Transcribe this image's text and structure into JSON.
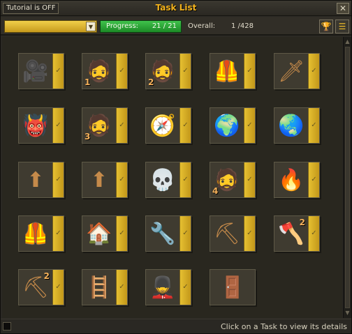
{
  "window": {
    "title": "Task List",
    "tutorial_label": "Tutorial is OFF",
    "close_symbol": "✕"
  },
  "toolbar": {
    "filter_value": "",
    "progress_label": "Progress:",
    "progress_value": "21 / 21",
    "progress_fraction": 1.0,
    "overall_label": "Overall:",
    "overall_value": "1 /428",
    "trophy_icon": "trophy-icon",
    "list_icon": "list-icon"
  },
  "tasks": [
    {
      "icon": "camera-rotate-icon",
      "glyph": "🎥",
      "badge": ""
    },
    {
      "icon": "guide-portrait-icon",
      "glyph": "🧔",
      "badge": "1"
    },
    {
      "icon": "guide-portrait-icon",
      "glyph": "🧔",
      "badge": "2"
    },
    {
      "icon": "armour-icon",
      "glyph": "🦺",
      "badge": ""
    },
    {
      "icon": "sword-icon",
      "glyph": "🗡",
      "badge": ""
    },
    {
      "icon": "goblin-icon",
      "glyph": "👹",
      "badge": ""
    },
    {
      "icon": "guide-portrait-icon",
      "glyph": "🧔",
      "badge": "3"
    },
    {
      "icon": "compass-icon",
      "glyph": "🧭",
      "badge": ""
    },
    {
      "icon": "globe-icon",
      "glyph": "🌍",
      "badge": ""
    },
    {
      "icon": "globe-compass-icon",
      "glyph": "🌏",
      "badge": ""
    },
    {
      "icon": "climb-wall-icon",
      "glyph": "⬆",
      "badge": ""
    },
    {
      "icon": "climb-wall-icon",
      "glyph": "⬆",
      "badge": ""
    },
    {
      "icon": "skull-hat-icon",
      "glyph": "💀",
      "badge": ""
    },
    {
      "icon": "guide-portrait-icon",
      "glyph": "🧔",
      "badge": "4"
    },
    {
      "icon": "torch-icon",
      "glyph": "🔥",
      "badge": ""
    },
    {
      "icon": "armour-down-icon",
      "glyph": "🦺",
      "badge": ""
    },
    {
      "icon": "house-icon",
      "glyph": "🏠",
      "badge": ""
    },
    {
      "icon": "tools-icon",
      "glyph": "🔧",
      "badge": ""
    },
    {
      "icon": "pickaxe-ore-icon",
      "glyph": "⛏",
      "badge": ""
    },
    {
      "icon": "hatchet-icon",
      "glyph": "🪓",
      "badge": "2"
    },
    {
      "icon": "pickaxe-icon",
      "glyph": "⛏",
      "badge": "2"
    },
    {
      "icon": "ladder-icon",
      "glyph": "🪜",
      "badge": ""
    },
    {
      "icon": "soldier-portrait-icon",
      "glyph": "💂",
      "badge": ""
    },
    {
      "icon": "door-icon",
      "glyph": "🚪",
      "badge": "",
      "locked": true
    }
  ],
  "check_symbol": "✓",
  "footer": {
    "hint": "Click on a Task to view its details"
  },
  "colors": {
    "title": "#f2b21c",
    "progress": "#2ea63a",
    "check": "#e6c031",
    "filter": "#e0b935"
  }
}
